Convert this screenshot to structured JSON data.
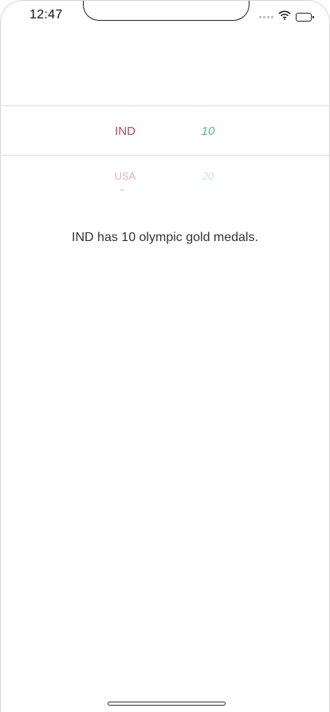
{
  "status_bar": {
    "time": "12:47",
    "icons": [
      "signal-dots-icon",
      "wifi-icon",
      "battery-icon"
    ]
  },
  "picker": {
    "columns": [
      "country",
      "medals"
    ],
    "rows": [
      {
        "country": "IND",
        "medals": "10",
        "state": "selected"
      },
      {
        "country": "USA",
        "medals": "20",
        "state": "unselected"
      }
    ],
    "colors": {
      "country_selected": "#b04a55",
      "medals_selected": "#4cc46a",
      "country_unselected": "#d8b4b9",
      "medals_unselected": "#c4ecc9"
    }
  },
  "result_text": "IND has 10 olympic gold medals."
}
